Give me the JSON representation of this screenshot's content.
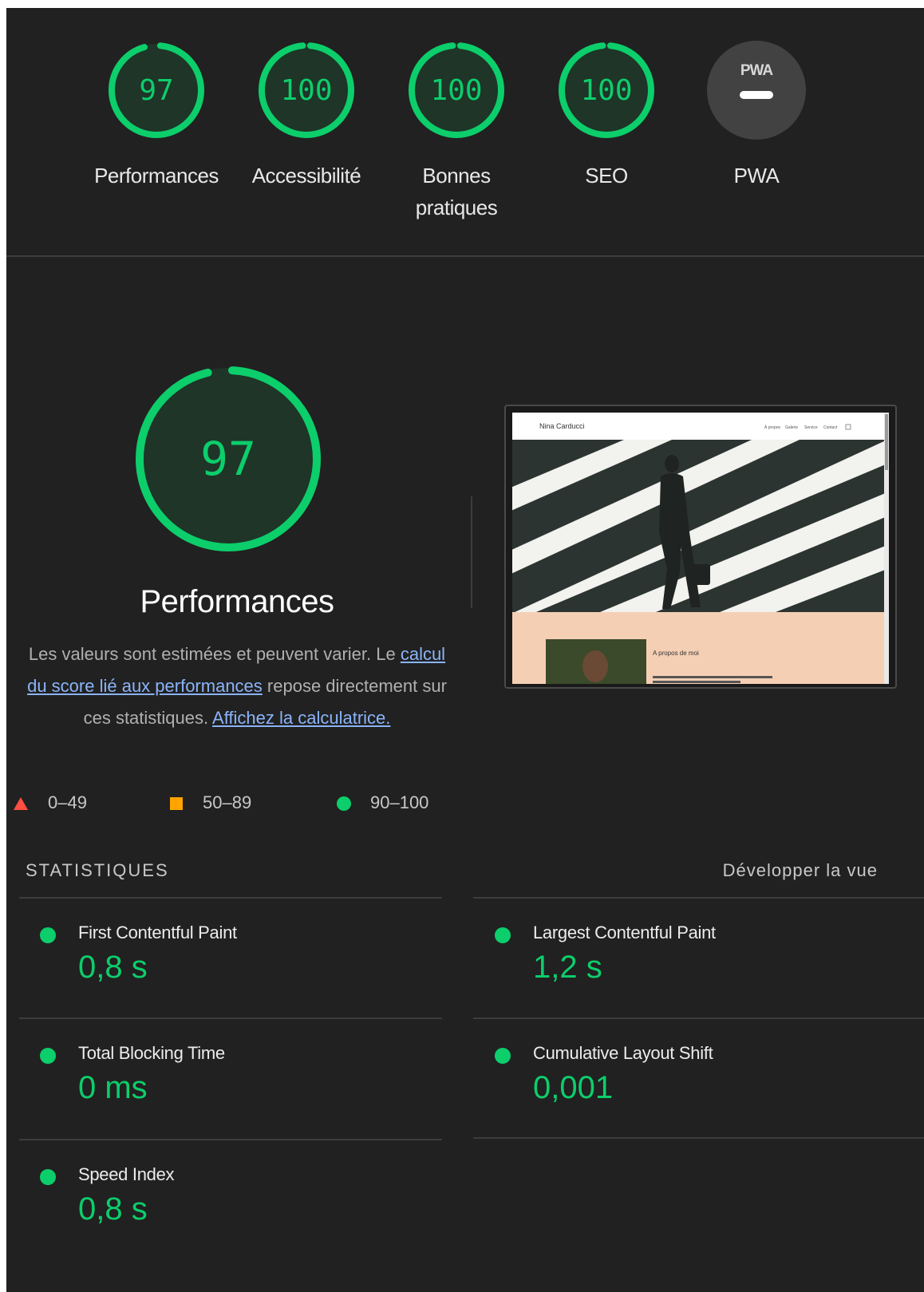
{
  "categories": [
    {
      "score": "97",
      "label": "Performances",
      "fraction": 0.97
    },
    {
      "score": "100",
      "label": "Accessibilité",
      "fraction": 1.0
    },
    {
      "score": "100",
      "label": "Bonnes pratiques",
      "fraction": 1.0
    },
    {
      "score": "100",
      "label": "SEO",
      "fraction": 1.0
    },
    {
      "badge": "PWA",
      "label": "PWA"
    }
  ],
  "performance": {
    "score": "97",
    "fraction": 0.97,
    "title": "Performances",
    "desc_part1": "Les valeurs sont estimées et peuvent varier. Le ",
    "desc_link1": "calcul du score lié aux performances",
    "desc_part2": " repose directement sur ces statistiques. ",
    "desc_link2": "Affichez la calculatrice."
  },
  "thumbnail": {
    "site_name": "Nina Carducci",
    "nav": [
      "À propos",
      "Galerie",
      "Service",
      "Contact"
    ],
    "about_heading": "A propos de moi"
  },
  "legend": [
    {
      "range": "0–49",
      "color": "#ff4e42",
      "shape": "triangle"
    },
    {
      "range": "50–89",
      "color": "#ffa400",
      "shape": "square"
    },
    {
      "range": "90–100",
      "color": "#0cce6b",
      "shape": "circle"
    }
  ],
  "metrics_header": {
    "title": "STATISTIQUES",
    "expand": "Développer la vue"
  },
  "metrics": [
    {
      "label": "First Contentful Paint",
      "value": "0,8 s"
    },
    {
      "label": "Largest Contentful Paint",
      "value": "1,2 s"
    },
    {
      "label": "Total Blocking Time",
      "value": "0 ms"
    },
    {
      "label": "Cumulative Layout Shift",
      "value": "0,001"
    },
    {
      "label": "Speed Index",
      "value": "0,8 s"
    }
  ],
  "colors": {
    "pass": "#0cce6b",
    "pass_bg": "#1e3528",
    "panel": "#212121"
  }
}
